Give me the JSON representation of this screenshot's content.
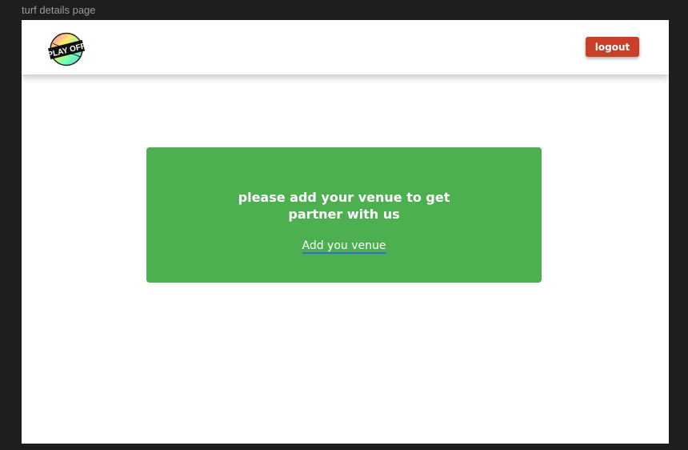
{
  "frame_label": "turf details page",
  "header": {
    "logo_text": "PLAY OFF",
    "logout_label": "logout"
  },
  "card": {
    "title_line1": "please add your venue to get",
    "title_line2": "partner with us",
    "link_label": "Add you venue"
  },
  "colors": {
    "card_bg": "#4caf50",
    "logout_bg": "#c8402a",
    "link_underline": "#2f6fd8"
  }
}
